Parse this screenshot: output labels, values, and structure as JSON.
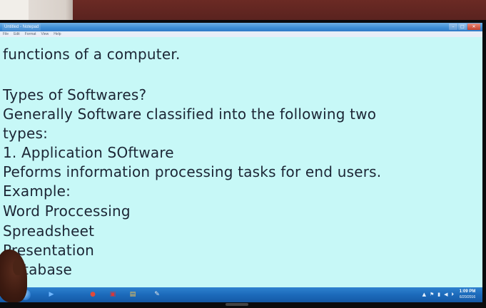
{
  "window": {
    "title": "Untitled - Notepad",
    "controls": [
      "–",
      "□",
      "✕"
    ]
  },
  "menu": [
    "File",
    "Edit",
    "Format",
    "View",
    "Help"
  ],
  "document": {
    "lines": [
      "functions of a  computer.",
      "",
      "Types of Softwares?",
      "Generally Software classified into the following two",
      "types:",
      "1. Application SOftware",
      "Peforms information processing tasks for end users.",
      "Example:",
      "Word Proccessing",
      "Spreadsheet",
      "Presentation",
      "Database"
    ]
  },
  "taskbar": {
    "start_icon": "windows-start-icon",
    "pinned": [
      {
        "name": "media-player-icon",
        "glyph": "▶",
        "color": "#6fb7ff"
      },
      {
        "name": "chrome-icon",
        "glyph": "●",
        "color": "#e04a3b"
      },
      {
        "name": "pdf-reader-icon",
        "glyph": "▣",
        "color": "#d7363a"
      },
      {
        "name": "folder-icon",
        "glyph": "▤",
        "color": "#f5c451"
      },
      {
        "name": "notepad-icon",
        "glyph": "✎",
        "color": "#e9e9e9"
      }
    ],
    "clock": {
      "time": "1:09 PM",
      "date": "6/20/2016"
    },
    "tray_icons": [
      "▲",
      "⚑",
      "▮",
      "◀",
      "⏵"
    ]
  },
  "colors": {
    "document_background": "#c7f8f7",
    "text": "#1c2635",
    "taskbar": "#1d6cbc"
  }
}
